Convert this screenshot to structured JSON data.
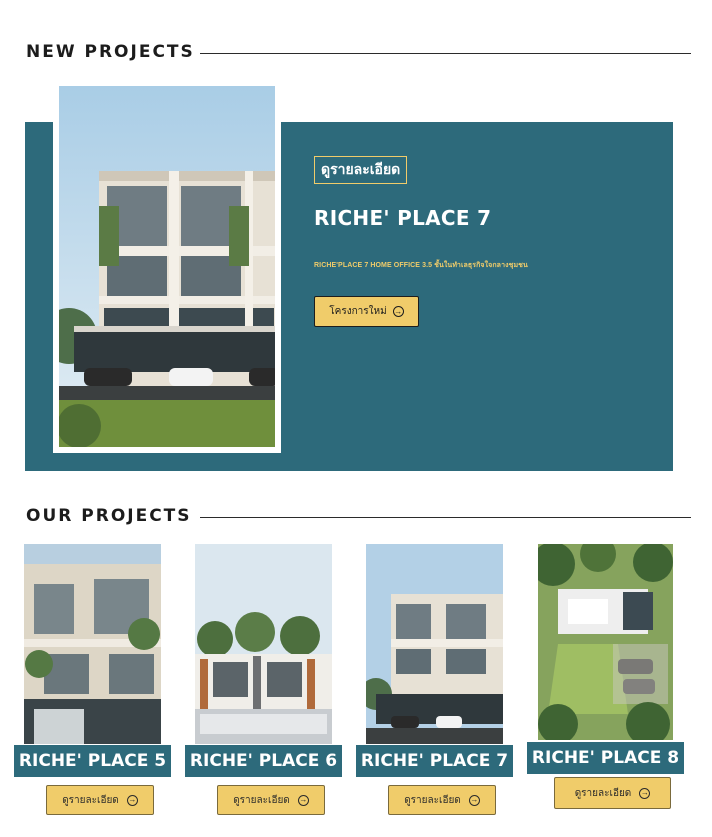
{
  "new_projects": {
    "heading": "NEW PROJECTS",
    "featured": {
      "detail_tag": "ดูรายละเอียด",
      "title": "RICHE' PLACE 7",
      "subtitle": "RICHE'PLACE 7 HOME OFFICE 3.5 ชั้นในทำเลธุรกิจใจกลางชุมชน",
      "button_label": "โครงการใหม่",
      "button_icon": "arrow-right-circle-icon"
    }
  },
  "our_projects": {
    "heading": "OUR PROJECTS",
    "cards": [
      {
        "title": "RICHE' PLACE 5",
        "button_label": "ดูรายละเอียด"
      },
      {
        "title": "RICHE' PLACE 6",
        "button_label": "ดูรายละเอียด"
      },
      {
        "title": "RICHE' PLACE 7",
        "button_label": "ดูรายละเอียด"
      },
      {
        "title": "RICHE' PLACE 8",
        "button_label": "ดูรายละเอียด"
      }
    ]
  },
  "colors": {
    "accent_teal": "#2d6a7b",
    "accent_gold": "#f0cc6a",
    "text_dark": "#1c1c1c"
  }
}
